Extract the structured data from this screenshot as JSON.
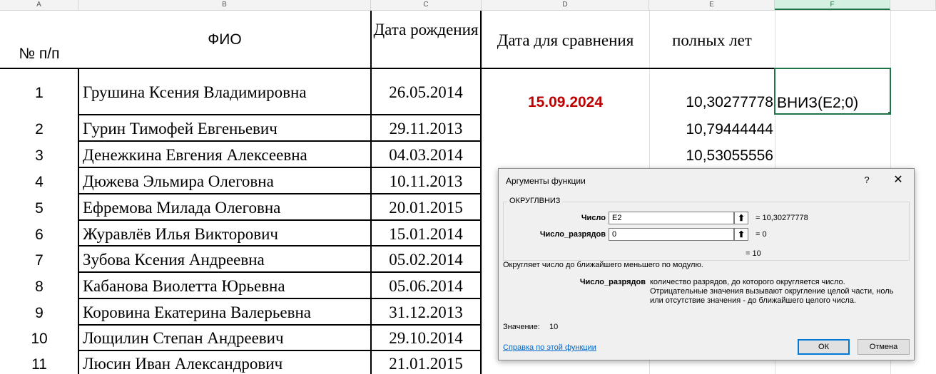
{
  "columns": [
    "A",
    "B",
    "C",
    "D",
    "E",
    "F"
  ],
  "headers": {
    "num": "№ п/п",
    "fio": "ФИО",
    "birth": "Дата рождения",
    "compare": "Дата для сравнения",
    "years": "полных лет"
  },
  "compare_date": "15.09.2024",
  "formula_edit": "ВНИЗ(E2;0)",
  "rows": [
    {
      "n": "1",
      "name": "Грушина Ксения Владимировна",
      "date": "26.05.2014",
      "years": "10,30277778"
    },
    {
      "n": "2",
      "name": "Гурин Тимофей Евгеньевич",
      "date": "29.11.2013",
      "years": "10,79444444"
    },
    {
      "n": "3",
      "name": "Денежкина Евгения Алексеевна",
      "date": "04.03.2014",
      "years": "10,53055556"
    },
    {
      "n": "4",
      "name": "Дюжева Эльмира Олеговна",
      "date": "10.11.2013",
      "years": ""
    },
    {
      "n": "5",
      "name": "Ефремова Милада Олеговна",
      "date": "20.01.2015",
      "years": ""
    },
    {
      "n": "6",
      "name": "Журавлёв Илья Викторович",
      "date": "15.01.2014",
      "years": ""
    },
    {
      "n": "7",
      "name": "Зубова Ксения Андреевна",
      "date": "05.02.2014",
      "years": ""
    },
    {
      "n": "8",
      "name": "Кабанова Виолетта Юрьевна",
      "date": "05.06.2014",
      "years": ""
    },
    {
      "n": "9",
      "name": "Коровина Екатерина Валерьевна",
      "date": "31.12.2013",
      "years": ""
    },
    {
      "n": "10",
      "name": "Лощилин Степан Андреевич",
      "date": "29.10.2014",
      "years": ""
    },
    {
      "n": "11",
      "name": "Люсин Иван Александрович",
      "date": "21.01.2015",
      "years": ""
    }
  ],
  "colors": {
    "accent_green": "#217346",
    "red_date": "#c00000",
    "link": "#0066cc"
  },
  "dialog": {
    "title": "Аргументы функции",
    "help_glyph": "?",
    "close_glyph": "✕",
    "function_name": "ОКРУГЛВНИЗ",
    "arg1_label": "Число",
    "arg1_value": "E2",
    "arg1_result": "= 10,30277778",
    "arg2_label": "Число_разрядов",
    "arg2_value": "0",
    "arg2_result": "= 0",
    "total_result": "= 10",
    "description": "Округляет число до ближайшего меньшего по модулю.",
    "param_name": "Число_разрядов",
    "param_desc_1": "количество разрядов, до которого округляется число.",
    "param_desc_2": "Отрицательные значения вызывают округление целой части, ноль",
    "param_desc_3": "или отсутствие значения - до ближайшего целого числа.",
    "value_label": "Значение:",
    "value": "10",
    "help_link": "Справка по этой функции",
    "ok_label": "ОК",
    "cancel_label": "Отмена",
    "ref_icon_glyph": "⬆"
  }
}
